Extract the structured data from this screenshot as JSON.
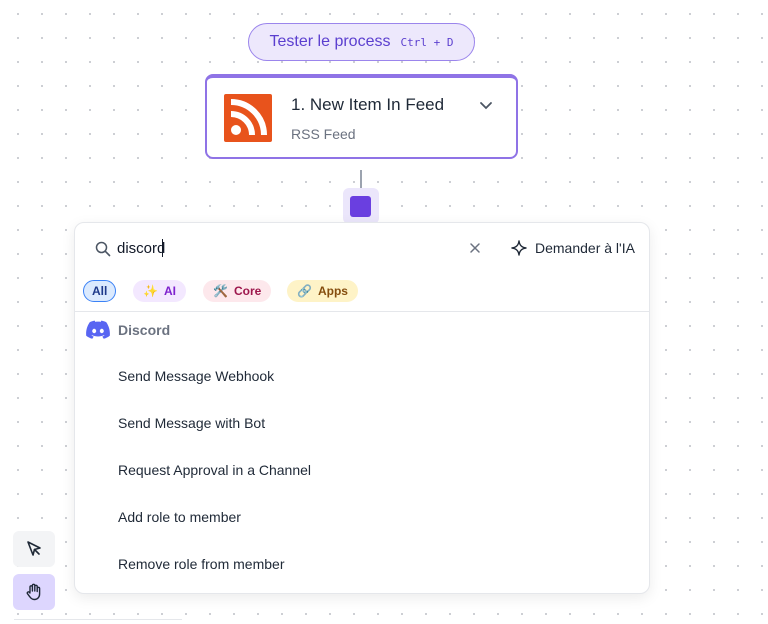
{
  "test_button": {
    "label": "Tester le process",
    "shortcut": "Ctrl + D"
  },
  "node": {
    "title": "1. New Item In Feed",
    "subtitle": "RSS Feed",
    "icon": "rss-icon",
    "accent": "#8f73e6",
    "icon_bg": "#e8531c"
  },
  "add_step": {
    "color": "#6a3fe0"
  },
  "search": {
    "value": "discord",
    "placeholder": "",
    "ask_ai_label": "Demander à l'IA"
  },
  "filters": [
    {
      "label": "All",
      "emoji": "",
      "active": true
    },
    {
      "label": "AI",
      "emoji": "✨",
      "active": false
    },
    {
      "label": "Core",
      "emoji": "🛠️",
      "active": false
    },
    {
      "label": "Apps",
      "emoji": "🔗",
      "active": false
    }
  ],
  "results": {
    "group": {
      "name": "Discord",
      "icon": "discord-icon",
      "color": "#5865f2"
    },
    "items": [
      "Send Message Webhook",
      "Send Message with Bot",
      "Request Approval in a Channel",
      "Add role to member",
      "Remove role from member"
    ]
  },
  "toolbar": {
    "select_icon": "pointer-icon",
    "pan_icon": "hand-icon"
  }
}
